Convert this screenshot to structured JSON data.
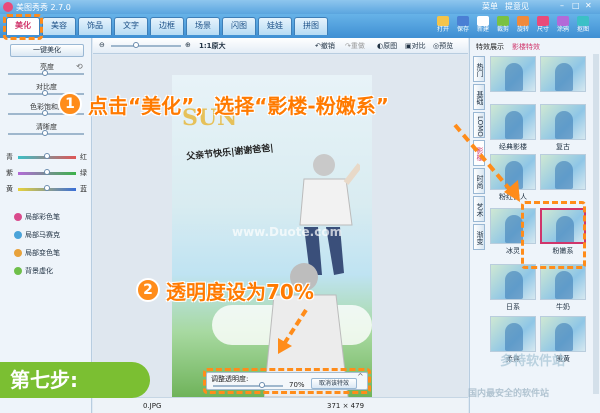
{
  "titlebar": {
    "title": "美图秀秀 2.7.0",
    "menu": "菜单",
    "feedback": "提意见"
  },
  "tabs": [
    {
      "label": "美化"
    },
    {
      "label": "美容"
    },
    {
      "label": "饰品"
    },
    {
      "label": "文字"
    },
    {
      "label": "边框"
    },
    {
      "label": "场景"
    },
    {
      "label": "闪图"
    },
    {
      "label": "娃娃"
    },
    {
      "label": "拼图"
    }
  ],
  "tools": [
    {
      "label": "打开"
    },
    {
      "label": "保存"
    },
    {
      "label": "新建"
    },
    {
      "label": "裁剪"
    },
    {
      "label": "旋转"
    },
    {
      "label": "尺寸"
    },
    {
      "label": "涂鸦"
    },
    {
      "label": "抠图"
    }
  ],
  "left": {
    "one_click": "一键美化",
    "sliders": [
      {
        "label": "亮度"
      },
      {
        "label": "对比度"
      },
      {
        "label": "色彩饱和度"
      },
      {
        "label": "清晰度"
      }
    ],
    "colors": [
      {
        "left": "青",
        "right": "红",
        "color": "#e05555"
      },
      {
        "left": "紫",
        "right": "绿",
        "color": "#3cb34a"
      },
      {
        "left": "黄",
        "right": "蓝",
        "color": "#3a6fd8"
      }
    ],
    "items": [
      {
        "label": "局部彩色笔",
        "color": "#d94a8c"
      },
      {
        "label": "局部马赛克",
        "color": "#4aa3d9"
      },
      {
        "label": "局部变色笔",
        "color": "#e8a23b"
      },
      {
        "label": "背景虚化",
        "color": "#6fbf4a"
      }
    ]
  },
  "viewbar": {
    "zoom": "1:1原大",
    "undo": "撤销",
    "redo": "重做",
    "original": "原图",
    "compare": "对比",
    "preview": "预览"
  },
  "canvas": {
    "sun_text": "SUN",
    "greeting": "父亲节快乐|谢谢爸爸|",
    "watermark": "www.Duote.com"
  },
  "opacity": {
    "label": "调整透明度:",
    "value": "70%",
    "cancel": "取消该特效"
  },
  "status": {
    "file": "0.JPG",
    "size": "371 × 479"
  },
  "right": {
    "header": "特效展示",
    "header2": "影楼特效",
    "vtabs": [
      {
        "label": "热门"
      },
      {
        "label": "基础"
      },
      {
        "label": "LOMO"
      },
      {
        "label": "影楼"
      },
      {
        "label": "时尚"
      },
      {
        "label": "艺术"
      },
      {
        "label": "渐变"
      }
    ],
    "thumbs": [
      {
        "label": ""
      },
      {
        "label": ""
      },
      {
        "label": "经典影楼"
      },
      {
        "label": "复古"
      },
      {
        "label": "粉红佳人"
      },
      {
        "label": ""
      },
      {
        "label": "冰灵"
      },
      {
        "label": "粉嫩系"
      },
      {
        "label": "日系"
      },
      {
        "label": "牛奶"
      },
      {
        "label": "柔焦"
      },
      {
        "label": "暖黄"
      }
    ]
  },
  "annotations": {
    "num1": "1",
    "text1": "点击“美化”，选择“影楼-粉嫩系”",
    "num2": "2",
    "text2": "透明度设为70%",
    "step": "第七步:"
  },
  "watermark2": {
    "text1": "多特软件站",
    "text2": "国内最安全的软件站"
  }
}
